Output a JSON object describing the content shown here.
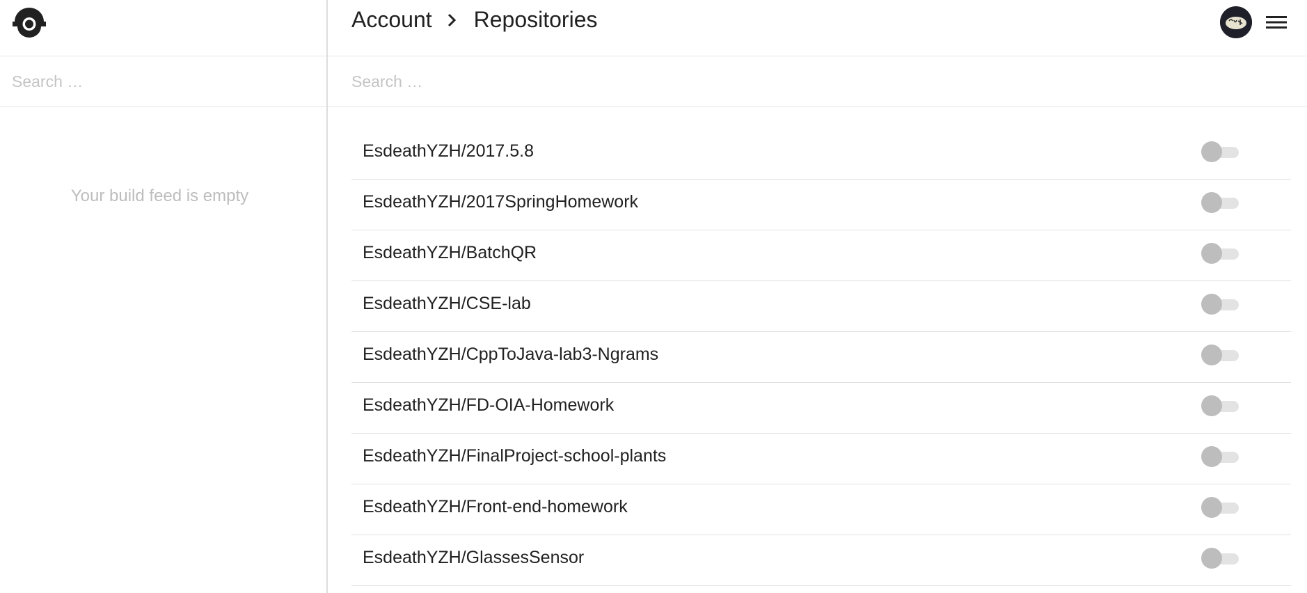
{
  "sidebar": {
    "logo_icon": "drone-logo-icon",
    "search": {
      "placeholder": "Search …",
      "value": ""
    },
    "empty_message": "Your build feed is empty"
  },
  "header": {
    "breadcrumb": [
      {
        "label": "Account"
      },
      {
        "label": "Repositories"
      }
    ],
    "separator_icon": "chevron-right-icon",
    "avatar_icon": "user-avatar",
    "menu_icon": "hamburger-menu-icon"
  },
  "main": {
    "search": {
      "placeholder": "Search …",
      "value": ""
    },
    "repositories": [
      {
        "name": "EsdeathYZH/2017.5.8",
        "active": false
      },
      {
        "name": "EsdeathYZH/2017SpringHomework",
        "active": false
      },
      {
        "name": "EsdeathYZH/BatchQR",
        "active": false
      },
      {
        "name": "EsdeathYZH/CSE-lab",
        "active": false
      },
      {
        "name": "EsdeathYZH/CppToJava-lab3-Ngrams",
        "active": false
      },
      {
        "name": "EsdeathYZH/FD-OIA-Homework",
        "active": false
      },
      {
        "name": "EsdeathYZH/FinalProject-school-plants",
        "active": false
      },
      {
        "name": "EsdeathYZH/Front-end-homework",
        "active": false
      },
      {
        "name": "EsdeathYZH/GlassesSensor",
        "active": false
      }
    ]
  },
  "colors": {
    "text": "#212121",
    "placeholder": "#c4c4c4",
    "muted": "#bdbdbd",
    "toggle_track": "#e3e3e3",
    "toggle_thumb": "#bdbdbd",
    "divider": "#e0e0e0"
  }
}
